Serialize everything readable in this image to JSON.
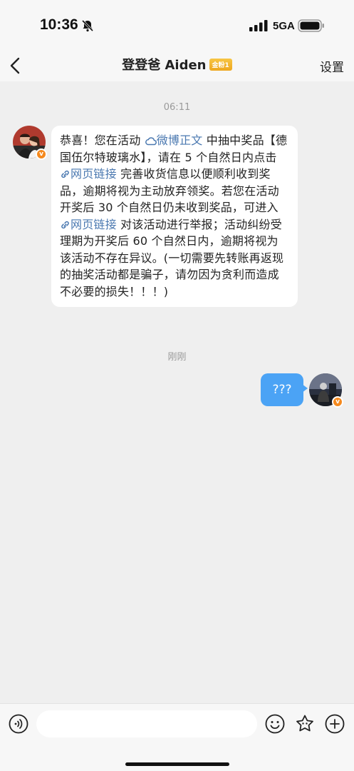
{
  "status_bar": {
    "time": "10:36",
    "network": "5GA"
  },
  "nav": {
    "title": "登登爸 Aiden",
    "badge": "金粉1",
    "settings": "设置"
  },
  "messages": {
    "incoming": {
      "time": "06:11",
      "segments": {
        "s1": "恭喜！您在活动 ",
        "link1": "微博正文",
        "s2": " 中抽中奖品【德国伍尔特玻璃水】，请在 5 个自然日内点击 ",
        "link2": "网页链接",
        "s3": " 完善收货信息以便顺利收到奖品，逾期将视为主动放弃领奖。若您在活动开奖后 30 个自然日仍未收到奖品，可进入 ",
        "link3": "网页链接",
        "s4": " 对该活动进行举报；活动纠纷受理期为开奖后 60 个自然日内，逾期将视为该活动不存在异议。(一切需要先转账再返现的抽奖活动都是骗子，请勿因为贪利而造成不必要的损失！！！)"
      }
    },
    "outgoing": {
      "time": "刚刚",
      "text": "???"
    }
  },
  "icons": {
    "back": "chevron-left-icon",
    "bell_muted": "bell-slash-icon",
    "weibo": "weibo-cloud-icon",
    "link": "link-icon",
    "voice": "voice-icon",
    "emoji": "emoji-icon",
    "sticker": "sticker-icon",
    "plus": "plus-icon"
  },
  "colors": {
    "link": "#4a78b0",
    "outgoing_bubble": "#4ba3f5",
    "verified_badge": "#f58a1f",
    "fan_badge": "#eea71f"
  }
}
